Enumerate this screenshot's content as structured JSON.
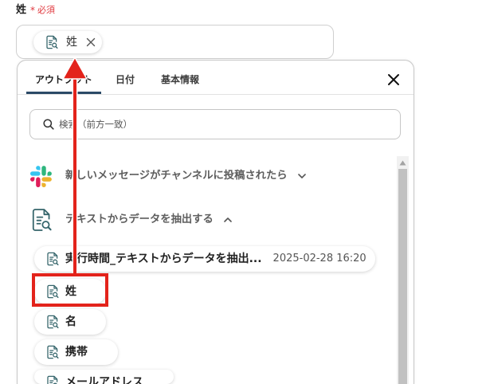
{
  "field": {
    "label": "姓",
    "required_mark": "*",
    "required_text": "必須",
    "selected_chip": {
      "icon": "doc-search-icon",
      "label": "姓"
    }
  },
  "panel": {
    "tabs": [
      {
        "label": "アウトプット",
        "active": true
      },
      {
        "label": "日付",
        "active": false
      },
      {
        "label": "基本情報",
        "active": false
      }
    ],
    "search": {
      "icon": "search-icon",
      "placeholder": "検索（前方一致）"
    },
    "sections": [
      {
        "icon": "slack-icon",
        "title": "新しいメッセージがチャンネルに投稿されたら",
        "expanded": false,
        "chevron": "chevron-down-icon"
      },
      {
        "icon": "doc-search-icon",
        "title": "テキストからデータを抽出する",
        "expanded": true,
        "chevron": "chevron-up-icon",
        "items": [
          {
            "icon": "doc-search-icon",
            "label": "実行時間_テキストからデータを抽出...",
            "value": "2025-02-28 16:20"
          },
          {
            "icon": "doc-search-icon",
            "label": "姓"
          },
          {
            "icon": "doc-search-icon",
            "label": "名"
          },
          {
            "icon": "doc-search-icon",
            "label": "携帯"
          },
          {
            "icon": "doc-search-icon",
            "label": "メールアドレス"
          }
        ]
      }
    ]
  },
  "colors": {
    "required": "#e0383e",
    "tab_indicator": "#2b4a67",
    "icon": "#35656b",
    "annotation": "#e3231b"
  }
}
